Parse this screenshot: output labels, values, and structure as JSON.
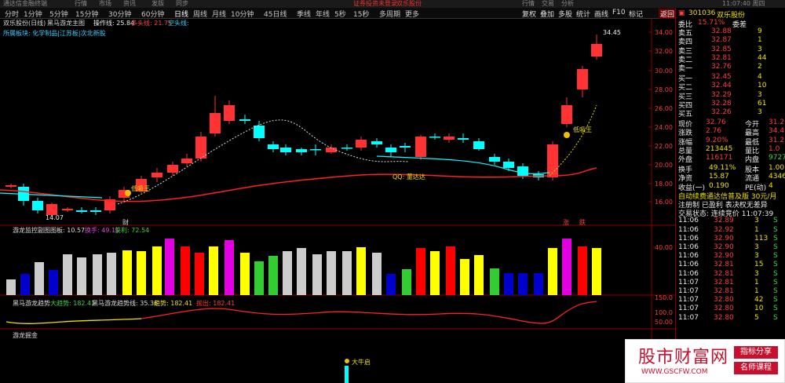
{
  "titlebar": {
    "items": [
      "通达信金融终端",
      "行情",
      "市场",
      "资讯",
      "发版",
      "同步",
      "",
      "证券投资未登录",
      "双乐股份",
      "",
      "",
      "",
      "",
      "",
      "",
      "",
      "",
      "",
      ""
    ],
    "right_items": [
      "行情",
      "交易",
      "分析",
      "",
      "",
      "",
      ""
    ],
    "time": "11:07:40 周四"
  },
  "periodbar": {
    "items": [
      "分时",
      "1分钟",
      "5分钟",
      "15分钟",
      "30分钟",
      "60分钟",
      "日线",
      "周线",
      "月线",
      "10分钟",
      "45日线",
      "季线",
      "年线",
      "5秒",
      "15秒",
      "多周期",
      "更多"
    ],
    "active": "日线"
  },
  "toolbar": {
    "items": [
      "复权",
      "叠加",
      "多股",
      "统计",
      "画线",
      "F10",
      "标记",
      "返回"
    ]
  },
  "main": {
    "title": "双乐股份(日线)",
    "indicator_line": "黑马游龙主图",
    "op_label": "操作线: 25.84",
    "multi_label": "多头线: 21.75",
    "empty_label": "空头线:",
    "sector": "所属板块: 化学制品|江苏板|次北新股",
    "high_label": "34.45",
    "low_label": "14.07",
    "signal_1": "低吸王",
    "signal_2": "低吸王",
    "qq_label": "QQ: 董达达",
    "marker_1": "财",
    "marker_2": "涨",
    "marker_3": "跌",
    "y_axis": [
      "34.00",
      "32.00",
      "30.00",
      "28.00",
      "26.00",
      "24.00",
      "22.00",
      "20.00",
      "18.00",
      "16.00"
    ]
  },
  "panel2": {
    "title": "游龙监控副图",
    "label_1": "图板: 10.57",
    "label_2": "换手: 49.11",
    "label_3": "获利: 72.54",
    "y_axis": [
      "40.00"
    ]
  },
  "panel3": {
    "title": "黑马游龙趋势",
    "label_1": "大趋势: 182.41",
    "label_2": "黑马游龙趋势线: 35.36",
    "label_3": "趋势: 182.41",
    "label_4": "抛出: 182.41",
    "y_axis": [
      "150.0",
      "100.0",
      "50.00"
    ]
  },
  "panel4": {
    "title": "游龙掘金",
    "signal": "大牛启"
  },
  "quote": {
    "code": "301036",
    "name": "双乐股份",
    "ratio_label": "委比",
    "ratio_value": "15.71%",
    "diff_label": "委差",
    "asks": [
      {
        "label": "卖五",
        "price": "32.88",
        "vol": "9"
      },
      {
        "label": "卖四",
        "price": "32.87",
        "vol": "1"
      },
      {
        "label": "卖三",
        "price": "32.85",
        "vol": "3"
      },
      {
        "label": "卖二",
        "price": "32.81",
        "vol": "44"
      },
      {
        "label": "卖一",
        "price": "32.76",
        "vol": "2"
      }
    ],
    "bids": [
      {
        "label": "买一",
        "price": "32.45",
        "vol": "4"
      },
      {
        "label": "买二",
        "price": "32.44",
        "vol": "10"
      },
      {
        "label": "买三",
        "price": "32.29",
        "vol": "3"
      },
      {
        "label": "买四",
        "price": "32.28",
        "vol": "61"
      },
      {
        "label": "买五",
        "price": "32.26",
        "vol": "3"
      }
    ],
    "stats": [
      {
        "l1": "现价",
        "v1": "32.76",
        "l2": "今开",
        "v2": "31.2"
      },
      {
        "l1": "涨跌",
        "v1": "2.76",
        "l2": "最高",
        "v2": "34.4"
      },
      {
        "l1": "涨幅",
        "v1": "9.20%",
        "l2": "最低",
        "v2": "31.2"
      },
      {
        "l1": "总量",
        "v1": "213445",
        "l2": "量比",
        "v2": "1.0"
      },
      {
        "l1": "外盘",
        "v1": "116171",
        "l2": "内盘",
        "v2": "9727"
      }
    ],
    "stats2": [
      {
        "l1": "换手",
        "v1": "49.11%",
        "l2": "股本",
        "v2": "1.00"
      },
      {
        "l1": "净资",
        "v1": "15.87",
        "l2": "流通",
        "v2": "4346"
      },
      {
        "l1": "收益(一)",
        "v1": "0.190",
        "l2": "PE(动)",
        "v2": "4"
      }
    ],
    "promo": "自动续费通达信普及版 30元/月",
    "reg_line": "注册制 已盈利 表决权无差异",
    "trade_status": "交易状态: 连续竞价 11:07:39",
    "ticks": [
      {
        "t": "11:06",
        "p": "32.89",
        "v": "3",
        "s": "S"
      },
      {
        "t": "11:06",
        "p": "32.92",
        "v": "1",
        "s": "S"
      },
      {
        "t": "11:06",
        "p": "32.90",
        "v": "113",
        "s": "S"
      },
      {
        "t": "11:06",
        "p": "32.90",
        "v": "3",
        "s": "S"
      },
      {
        "t": "11:06",
        "p": "32.90",
        "v": "3",
        "s": "S"
      },
      {
        "t": "11:06",
        "p": "32.81",
        "v": "15",
        "s": "S"
      },
      {
        "t": "11:06",
        "p": "32.81",
        "v": "3",
        "s": "S"
      },
      {
        "t": "11:07",
        "p": "32.81",
        "v": "1",
        "s": "S"
      },
      {
        "t": "11:07",
        "p": "32.81",
        "v": "1",
        "s": "S"
      },
      {
        "t": "11:07",
        "p": "32.80",
        "v": "42",
        "s": "S"
      },
      {
        "t": "11:07",
        "p": "32.80",
        "v": "10",
        "s": "S"
      },
      {
        "t": "11:07",
        "p": "32.80",
        "v": "5",
        "s": "S"
      }
    ]
  },
  "watermark": {
    "title": "股市财富网",
    "url": "WWW.GSCFW.COM",
    "tag1": "指标分享",
    "tag2": "名师课程"
  }
}
